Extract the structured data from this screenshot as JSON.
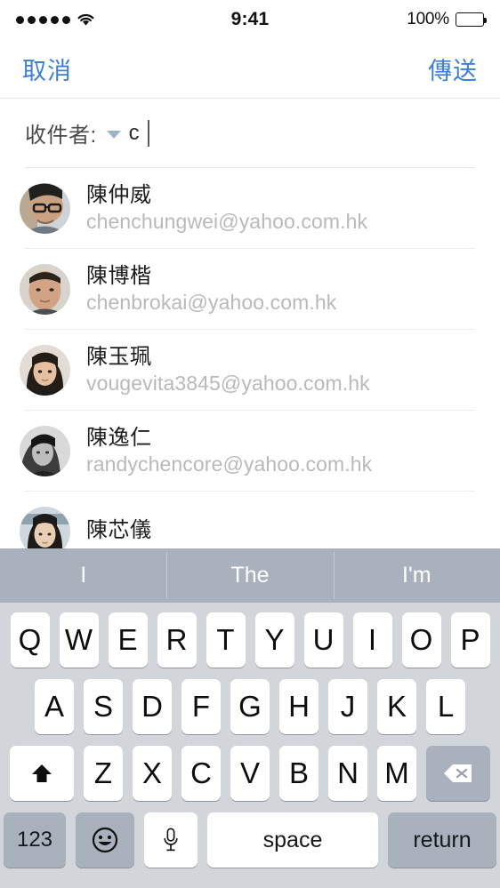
{
  "status_bar": {
    "signal_dots": 5,
    "wifi_icon": "wifi-icon",
    "time": "9:41",
    "battery_percent": "100%",
    "battery_icon": "battery-full-icon"
  },
  "nav_bar": {
    "cancel_label": "取消",
    "send_label": "傳送",
    "accent_color": "#3d7fd6"
  },
  "recipient_field": {
    "label": "收件者:",
    "expand_icon": "chevron-down-icon",
    "value": "c",
    "placeholder": ""
  },
  "contacts": [
    {
      "name": "陳仲威",
      "email": "chenchungwei@yahoo.com.hk",
      "avatar_icon": "avatar-photo-man-glasses"
    },
    {
      "name": "陳博楷",
      "email": "chenbrokai@yahoo.com.hk",
      "avatar_icon": "avatar-photo-man-short-hair"
    },
    {
      "name": "陳玉珮",
      "email": "vougevita3845@yahoo.com.hk",
      "avatar_icon": "avatar-photo-woman-long-hair"
    },
    {
      "name": "陳逸仁",
      "email": "randychencore@yahoo.com.hk",
      "avatar_icon": "avatar-photo-man-bw"
    },
    {
      "name": "陳芯儀",
      "email": "",
      "avatar_icon": "avatar-photo-woman-bob"
    }
  ],
  "keyboard": {
    "predictions": [
      "I",
      "The",
      "I'm"
    ],
    "row1": [
      "Q",
      "W",
      "E",
      "R",
      "T",
      "Y",
      "U",
      "I",
      "O",
      "P"
    ],
    "row2": [
      "A",
      "S",
      "D",
      "F",
      "G",
      "H",
      "J",
      "K",
      "L"
    ],
    "row3": [
      "Z",
      "X",
      "C",
      "V",
      "B",
      "N",
      "M"
    ],
    "shift_icon": "shift-arrow-icon",
    "backspace_icon": "backspace-delete-icon",
    "numbers_label": "123",
    "emoji_icon": "emoji-smiley-icon",
    "dictation_icon": "microphone-icon",
    "space_label": "space",
    "return_label": "return",
    "bar_color": "#a9b2bc",
    "body_color": "#d2d6db"
  }
}
